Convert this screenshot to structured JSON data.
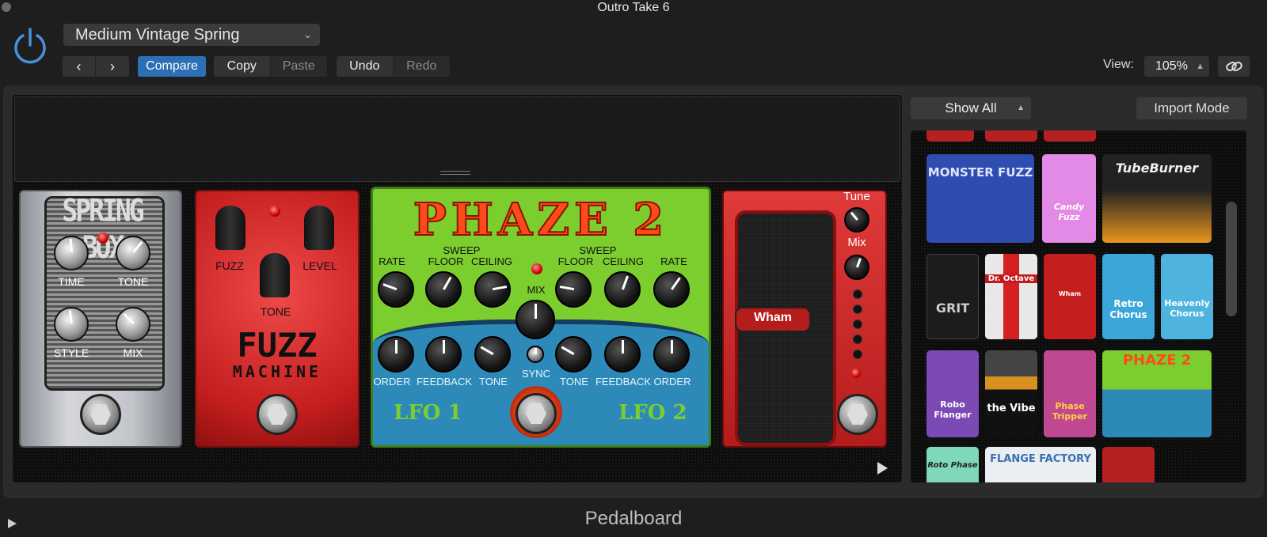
{
  "window": {
    "title": "Outro Take 6"
  },
  "header": {
    "preset": "Medium Vintage Spring",
    "prev": "‹",
    "next": "›",
    "compare": "Compare",
    "copy": "Copy",
    "paste": "Paste",
    "undo": "Undo",
    "redo": "Redo",
    "view_label": "View:",
    "zoom": "105%"
  },
  "browser": {
    "filter": "Show All",
    "import_mode": "Import Mode",
    "thumbnails": [
      "MONSTER FUZZ",
      "Candy Fuzz",
      "TubeBurner",
      "GRIT",
      "Dr. Octave",
      "Wham",
      "Retro Chorus",
      "Heavenly Chorus",
      "Robo Flanger",
      "the Vibe",
      "Phase Tripper",
      "PHAZE 2",
      "Roto Phase",
      "FLANGE FACTORY"
    ]
  },
  "pedals": {
    "spring_box": {
      "title": "SPRING BOX",
      "knobs": [
        "TIME",
        "TONE",
        "STYLE",
        "MIX"
      ]
    },
    "fuzz": {
      "title1": "FUZZ",
      "title2": "MACHINE",
      "knobs": [
        "FUZZ",
        "LEVEL",
        "TONE"
      ]
    },
    "phaze": {
      "title": "PHAZE 2",
      "sweep": "SWEEP",
      "top_labels": [
        "RATE",
        "FLOOR",
        "CEILING",
        "FLOOR",
        "CEILING",
        "RATE"
      ],
      "mix": "MIX",
      "bottom_labels": [
        "ORDER",
        "FEEDBACK",
        "TONE",
        "TONE",
        "FEEDBACK",
        "ORDER"
      ],
      "sync": "SYNC",
      "lfo1": "LFO 1",
      "lfo2": "LFO 2"
    },
    "wham": {
      "logo": "Wham",
      "tune": "Tune",
      "mix": "Mix"
    }
  },
  "footer": {
    "label": "Pedalboard"
  },
  "colors": {
    "accent": "#2c6fb4",
    "background": "#1e1e1e",
    "panel": "#2b2b2b"
  }
}
